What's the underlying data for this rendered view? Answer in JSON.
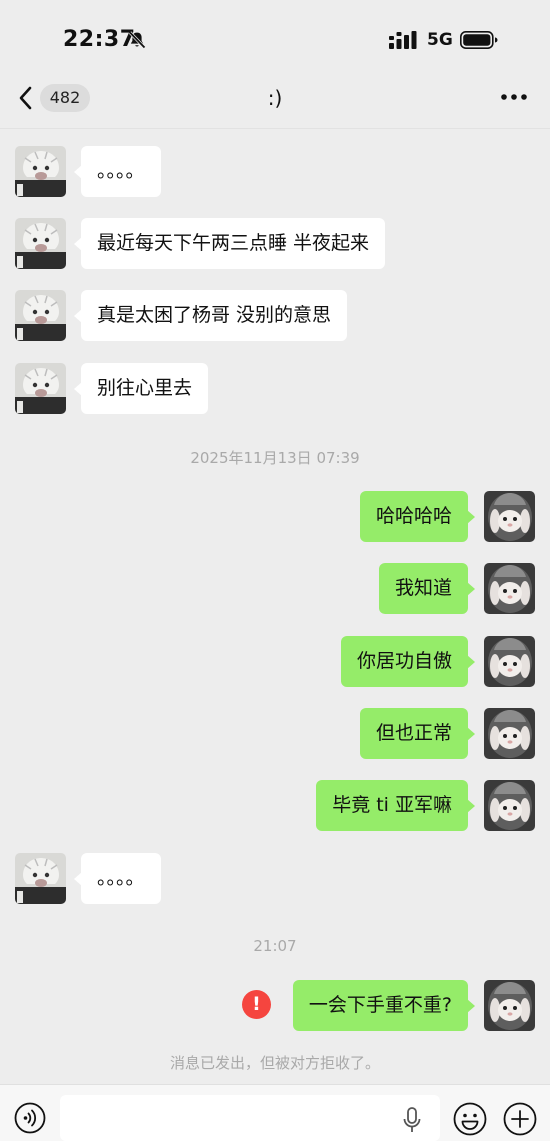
{
  "status_bar": {
    "time": "22:37",
    "network": "5G"
  },
  "nav": {
    "unread_count": "482",
    "title": ":)"
  },
  "messages": [
    {
      "side": "in",
      "text": "。。。。"
    },
    {
      "side": "in",
      "text": "最近每天下午两三点睡 半夜起来"
    },
    {
      "side": "in",
      "text": "真是太困了杨哥 没别的意思"
    },
    {
      "side": "in",
      "text": "别往心里去"
    },
    {
      "side": "out",
      "text": "哈哈哈哈"
    },
    {
      "side": "out",
      "text": "我知道"
    },
    {
      "side": "out",
      "text": "你居功自傲"
    },
    {
      "side": "out",
      "text": "但也正常"
    },
    {
      "side": "out",
      "text": "毕竟 ti 亚军嘛"
    },
    {
      "side": "in",
      "text": "。。。。"
    },
    {
      "side": "out",
      "text": "一会下手重不重?"
    }
  ],
  "time_separators": [
    "2025年11月13日 07:39",
    "21:07"
  ],
  "error_badge": "!",
  "reject_notice": "消息已发出，但被对方拒收了。",
  "input": {
    "value": "",
    "placeholder": ""
  },
  "colors": {
    "background": "#ededed",
    "incoming_bubble": "#ffffff",
    "outgoing_bubble": "#95ec69",
    "error": "#f5453f",
    "meta_text": "#a9a9a9"
  },
  "icons": {
    "back": "chevron-left-icon",
    "more": "more-dots-icon",
    "mute": "bell-slash-icon",
    "signal": "signal-bars-icon",
    "battery": "battery-icon",
    "voice": "voice-toggle-icon",
    "mic": "microphone-icon",
    "emoji": "emoji-icon",
    "plus": "plus-circle-icon"
  }
}
